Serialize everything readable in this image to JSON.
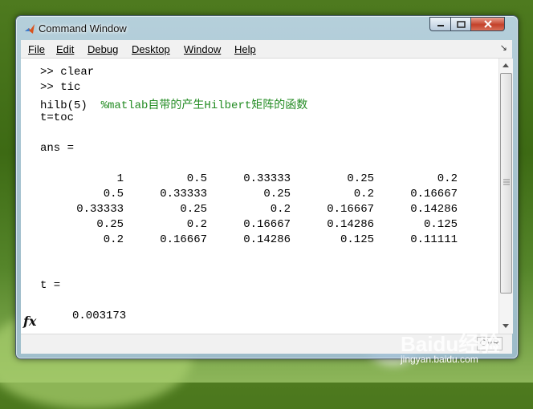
{
  "window": {
    "title": "Command Window"
  },
  "menu": {
    "items": [
      {
        "label": "File"
      },
      {
        "label": "Edit"
      },
      {
        "label": "Debug"
      },
      {
        "label": "Desktop"
      },
      {
        "label": "Window"
      },
      {
        "label": "Help"
      }
    ]
  },
  "console": {
    "line1": ">> clear",
    "line2": ">> tic",
    "line3_code": "hilb(5)  ",
    "line3_comment": "%matlab自带的产生Hilbert矩阵的函数",
    "line4": "t=toc",
    "ans_label": "ans =",
    "matrix": [
      [
        "1",
        "0.5",
        "0.33333",
        "0.25",
        "0.2"
      ],
      [
        "0.5",
        "0.33333",
        "0.25",
        "0.2",
        "0.16667"
      ],
      [
        "0.33333",
        "0.25",
        "0.2",
        "0.16667",
        "0.14286"
      ],
      [
        "0.25",
        "0.2",
        "0.16667",
        "0.14286",
        "0.125"
      ],
      [
        "0.2",
        "0.16667",
        "0.14286",
        "0.125",
        "0.11111"
      ]
    ],
    "t_label": "t =",
    "t_value": "0.003173",
    "fx": "fx"
  },
  "status": {
    "mode": "OVR"
  },
  "watermark": {
    "brand": "Baidu经验",
    "url": "jingyan.baidu.com"
  },
  "colors": {
    "comment": "#228b22",
    "close_button": "#c4412a"
  }
}
